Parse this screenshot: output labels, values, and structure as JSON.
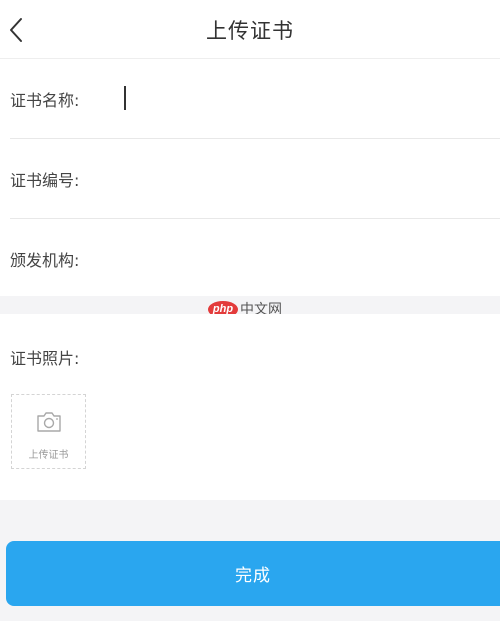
{
  "header": {
    "title": "上传证书",
    "back_icon": "chevron-left-icon"
  },
  "form": {
    "fields": [
      {
        "label": "证书名称:",
        "value": "",
        "placeholder": ""
      },
      {
        "label": "证书编号:",
        "value": "",
        "placeholder": ""
      },
      {
        "label": "颁发机构:",
        "value": "",
        "placeholder": ""
      }
    ]
  },
  "watermark": {
    "logo": "php",
    "text": "中文网"
  },
  "photo": {
    "label": "证书照片:",
    "upload_label": "上传证书",
    "upload_icon": "camera-icon"
  },
  "actions": {
    "done_label": "完成"
  },
  "colors": {
    "accent": "#2aa6ef",
    "background": "#f4f4f6",
    "text": "#444444",
    "watermark_logo": "#e33b3b"
  }
}
